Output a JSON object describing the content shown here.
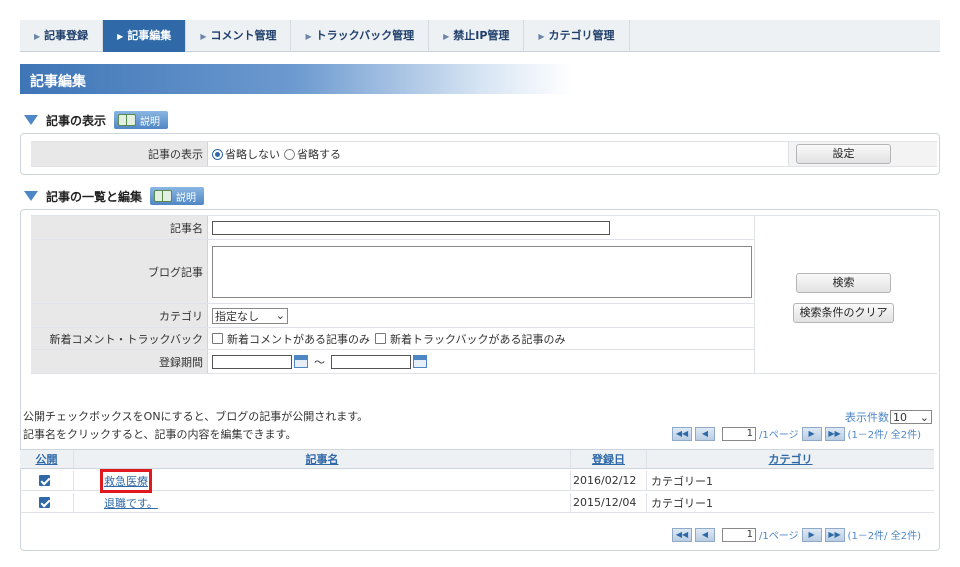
{
  "tabs": [
    {
      "label": "記事登録",
      "active": false
    },
    {
      "label": "記事編集",
      "active": true
    },
    {
      "label": "コメント管理",
      "active": false
    },
    {
      "label": "トラックバック管理",
      "active": false
    },
    {
      "label": "禁止IP管理",
      "active": false
    },
    {
      "label": "カテゴリ管理",
      "active": false
    }
  ],
  "page_title": "記事編集",
  "display_section": {
    "title": "記事の表示",
    "help_label": "説明",
    "row_label": "記事の表示",
    "options": [
      "省略しない",
      "省略する"
    ],
    "selected": "省略しない",
    "set_button": "設定"
  },
  "list_section": {
    "title": "記事の一覧と編集",
    "help_label": "説明",
    "fields": {
      "title_label": "記事名",
      "body_label": "ブログ記事",
      "category_label": "カテゴリ",
      "category_value": "指定なし",
      "new_label": "新着コメント・トラックバック",
      "new_comment_option": "新着コメントがある記事のみ",
      "new_trackback_option": "新着トラックバックがある記事のみ",
      "period_label": "登録期間",
      "period_sep": "～"
    },
    "search_button": "検索",
    "clear_button": "検索条件のクリア"
  },
  "notes": {
    "line1": "公開チェックボックスをONにすると、ブログの記事が公開されます。",
    "line2": "記事名をクリックすると、記事の内容を編集できます。"
  },
  "per_page": {
    "label": "表示件数",
    "value": "10"
  },
  "pager": {
    "page": "1",
    "suffix": "/1ページ",
    "count": "(1－2件/ 全2件)"
  },
  "table": {
    "headers": {
      "public": "公開",
      "title": "記事名",
      "date": "登録日",
      "category": "カテゴリ"
    },
    "rows": [
      {
        "public": true,
        "title": "救急医療",
        "date": "2016/02/12",
        "category": "カテゴリー1"
      },
      {
        "public": true,
        "title": "退職です。",
        "date": "2015/12/04",
        "category": "カテゴリー1"
      }
    ]
  },
  "colors": {
    "accent": "#2f69a8",
    "highlight": "#e0191f"
  }
}
